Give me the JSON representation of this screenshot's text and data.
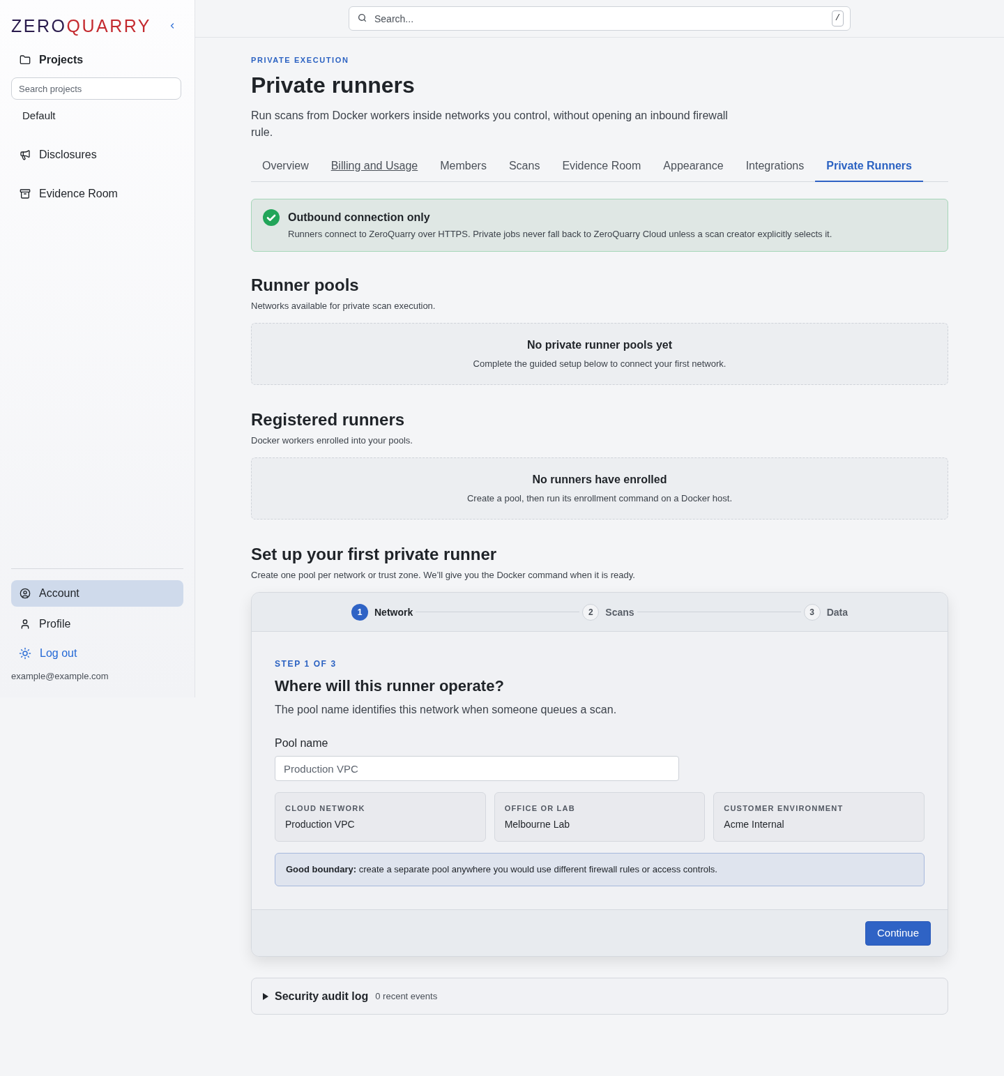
{
  "sidebar": {
    "logo": {
      "part_1": "ZERO",
      "part_2": "QUARRY"
    },
    "projects": {
      "title": "Projects",
      "search": {
        "placeholder": "Search projects"
      },
      "items": [
        {
          "label": "Default",
          "selected": false
        }
      ]
    },
    "nav": [
      {
        "label": "Disclosures",
        "selected": false
      },
      {
        "label": "Evidence Room",
        "selected": false
      }
    ],
    "account_menu": [
      {
        "label": "Account",
        "selected": true
      },
      {
        "label": "Profile",
        "selected": false
      }
    ],
    "logout": "Log out",
    "email": "example@example.com"
  },
  "topbar": {
    "search": {
      "placeholder": "Search...",
      "shortcut": "/"
    }
  },
  "header": {
    "eyebrow": "PRIVATE EXECUTION",
    "title": "Private runners",
    "description": "Run scans from Docker workers inside networks you control, without opening an inbound firewall rule."
  },
  "tabs": [
    {
      "label": "Overview",
      "selected": false,
      "hovered": false
    },
    {
      "label": "Billing and Usage",
      "selected": false,
      "hovered": true
    },
    {
      "label": "Members",
      "selected": false,
      "hovered": false
    },
    {
      "label": "Scans",
      "selected": false,
      "hovered": false
    },
    {
      "label": "Evidence Room",
      "selected": false,
      "hovered": false
    },
    {
      "label": "Appearance",
      "selected": false,
      "hovered": false
    },
    {
      "label": "Integrations",
      "selected": false,
      "hovered": false
    },
    {
      "label": "Private Runners",
      "selected": true,
      "hovered": false
    }
  ],
  "alert": {
    "kind": "success",
    "title": "Outbound connection only",
    "text": "Runners connect to ZeroQuarry over HTTPS. Private jobs never fall back to ZeroQuarry Cloud unless a scan creator explicitly selects it."
  },
  "sections": [
    {
      "title": "Runner pools",
      "subtitle": "Networks available for private scan execution.",
      "empty_state": {
        "title": "No private runner pools yet",
        "text": "Complete the guided setup below to connect your first network."
      }
    },
    {
      "title": "Registered runners",
      "subtitle": "Docker workers enrolled into your pools.",
      "empty_state": {
        "title": "No runners have enrolled",
        "text": "Create a pool, then run its enrollment command on a Docker host."
      }
    }
  ],
  "setup": {
    "title": "Set up your first private runner",
    "subtitle": "Create one pool per network or trust zone. We’ll give you the Docker command when it is ready.",
    "steps": [
      {
        "number": "1",
        "label": "Network",
        "selected": true
      },
      {
        "number": "2",
        "label": "Scans",
        "selected": false
      },
      {
        "number": "3",
        "label": "Data",
        "selected": false
      }
    ],
    "eyebrow": "STEP 1 OF 3",
    "question": "Where will this runner operate?",
    "description": "The pool name identifies this network when someone queues a scan.",
    "field": {
      "label": "Pool name",
      "placeholder": "Production VPC"
    },
    "examples": [
      {
        "label": "CLOUD NETWORK",
        "value": "Production VPC"
      },
      {
        "label": "OFFICE OR LAB",
        "value": "Melbourne Lab"
      },
      {
        "label": "CUSTOMER ENVIRONMENT",
        "value": "Acme Internal"
      }
    ],
    "tip": "**Good boundary:** create a separate pool anywhere you would use different firewall rules or access controls.",
    "button": "Continue"
  },
  "audit_log": {
    "title": "Security audit log",
    "count": "0 recent events",
    "expanded": false
  }
}
